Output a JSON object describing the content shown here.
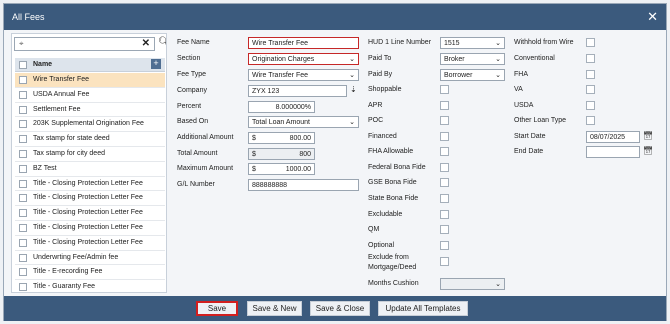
{
  "window": {
    "title": "All Fees"
  },
  "fee_list": {
    "search_value": "",
    "header": "Name",
    "items": [
      "Wire Transfer Fee",
      "USDA Annual Fee",
      "Settlement Fee",
      "203K Supplemental Origination Fee",
      "Tax stamp for state deed",
      "Tax stamp for city deed",
      "BZ Test",
      "Title - Closing Protection Letter Fee",
      "Title - Closing Protection Letter Fee",
      "Title - Closing Protection Letter Fee",
      "Title - Closing Protection Letter Fee",
      "Title - Closing Protection Letter Fee",
      "Underwrting Fee/Admin fee",
      "Title - E-recording Fee",
      "Title - Guaranty Fee"
    ]
  },
  "form": {
    "fee_name_label": "Fee Name",
    "fee_name": "Wire Transfer Fee",
    "section_label": "Section",
    "section": "Origination Charges",
    "fee_type_label": "Fee Type",
    "fee_type": "Wire Transfer Fee",
    "company_label": "Company",
    "company": "ZYX 123",
    "percent_label": "Percent",
    "percent": "8.000000%",
    "based_on_label": "Based On",
    "based_on": "Total Loan Amount",
    "additional_amount_label": "Additional Amount",
    "additional_amount": "800.00",
    "total_amount_label": "Total Amount",
    "total_amount": "800",
    "maximum_amount_label": "Maximum Amount",
    "maximum_amount": "1000.00",
    "gl_number_label": "G/L Number",
    "gl_number": "888888888",
    "currency": "$"
  },
  "mid": {
    "hud_label": "HUD 1 Line Number",
    "hud": "1515",
    "paid_to_label": "Paid To",
    "paid_to": "Broker",
    "paid_by_label": "Paid By",
    "paid_by": "Borrower",
    "shoppable": "Shoppable",
    "apr": "APR",
    "poc": "POC",
    "financed": "Financed",
    "fha_allowable": "FHA Allowable",
    "federal_bona_fide": "Federal Bona Fide",
    "gse_bona_fide": "GSE Bona Fide",
    "state_bona_fide": "State Bona Fide",
    "excludable": "Excludable",
    "qm": "QM",
    "optional": "Optional",
    "exclude_line1": "Exclude from",
    "exclude_line2": "Mortgage/Deed",
    "months_cushion": "Months Cushion"
  },
  "rightcol": {
    "withhold": "Withhold from Wire",
    "conventional": "Conventional",
    "fha": "FHA",
    "va": "VA",
    "usda": "USDA",
    "other_loan_type": "Other Loan Type",
    "start_date_label": "Start Date",
    "start_date": "08/07/2025",
    "end_date_label": "End Date",
    "end_date": ""
  },
  "buttons": {
    "save": "Save",
    "save_new": "Save & New",
    "save_close": "Save & Close",
    "update_all": "Update All Templates"
  }
}
